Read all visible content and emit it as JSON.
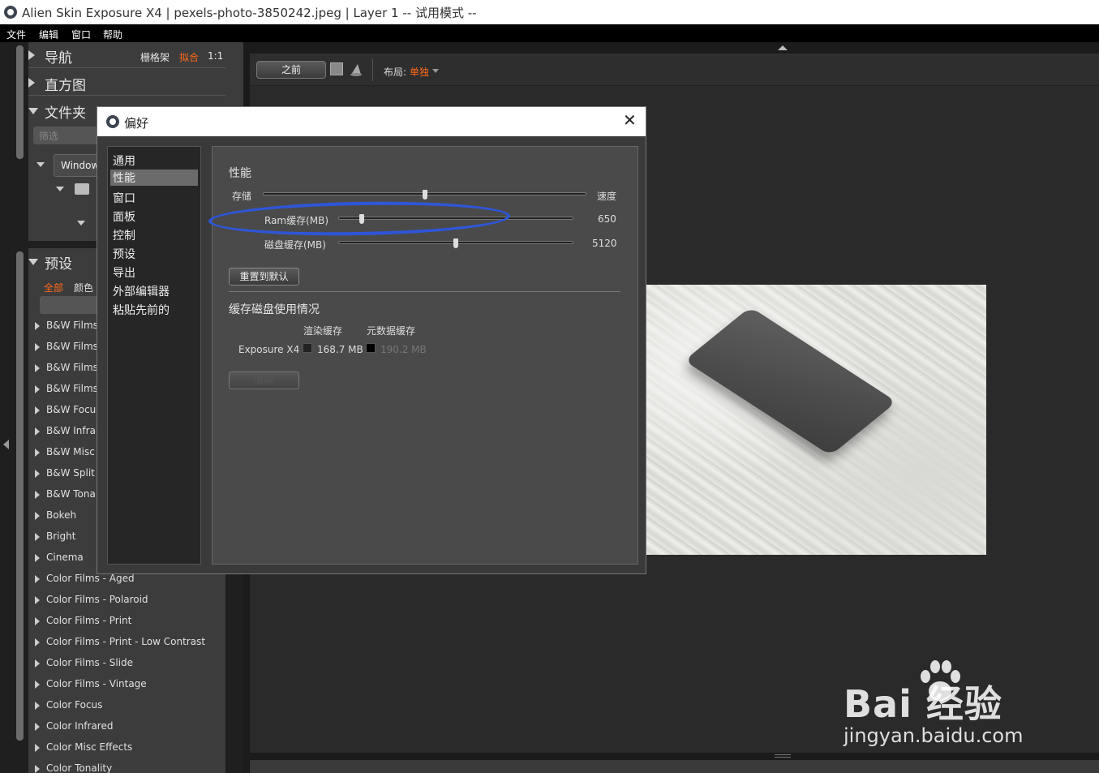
{
  "window": {
    "title": "Alien Skin Exposure X4 | pexels-photo-3850242.jpeg | Layer 1 -- 试用模式 --"
  },
  "menu": [
    "文件",
    "编辑",
    "窗口",
    "帮助"
  ],
  "left_panel": {
    "navigation": {
      "label": "导航",
      "options": [
        "栅格架",
        "拟合",
        "1:1"
      ],
      "active_option": "拟合"
    },
    "histogram": {
      "label": "直方图"
    },
    "folders": {
      "label": "文件夹",
      "filter_placeholder": "筛选",
      "drive_label": "Window"
    },
    "presets": {
      "label": "预设",
      "tabs": [
        "全部",
        "颜色"
      ],
      "active_tab": "全部",
      "items": [
        "B&W Films",
        "B&W Films",
        "B&W Films",
        "B&W Films",
        "B&W Focus",
        "B&W Infrar",
        "B&W Misc",
        "B&W Split T",
        "B&W Tonal",
        "Bokeh",
        "Bright",
        "Cinema",
        "Color Films - Aged",
        "Color Films - Polaroid",
        "Color Films - Print",
        "Color Films - Print - Low Contrast",
        "Color Films - Slide",
        "Color Films - Vintage",
        "Color Focus",
        "Color Infrared",
        "Color Misc Effects",
        "Color Tonality"
      ]
    }
  },
  "toolbar": {
    "before_label": "之前",
    "layout_label": "布局:",
    "layout_value": "单独"
  },
  "dialog": {
    "title": "偏好",
    "close_glyph": "✕",
    "categories": [
      "通用",
      "性能",
      "窗口",
      "面板",
      "控制",
      "预设",
      "导出",
      "外部编辑器",
      "粘贴先前的"
    ],
    "selected_category": "性能",
    "performance": {
      "heading": "性能",
      "storage_label": "存储",
      "speed_label": "速度",
      "storage_speed_fraction": 0.5,
      "ram_label": "Ram缓存(MB)",
      "ram_value": "650",
      "ram_fraction": 0.1,
      "disk_label": "磁盘缓存(MB)",
      "disk_value": "5120",
      "disk_fraction": 0.5,
      "reset_button": "重置到默认"
    },
    "cache_usage": {
      "heading": "缓存磁盘使用情况",
      "col_render": "渲染缓存",
      "col_meta": "元数据缓存",
      "row_name": "Exposure X4",
      "render_value": "168.7 MB",
      "meta_value": "190.2 MB",
      "clear_button": "清除"
    }
  },
  "watermark": {
    "brand": "Bai  经验",
    "url": "jingyan.baidu.com"
  },
  "colors": {
    "accent": "#ff6a1a",
    "highlight_ring": "#2f56d8"
  }
}
